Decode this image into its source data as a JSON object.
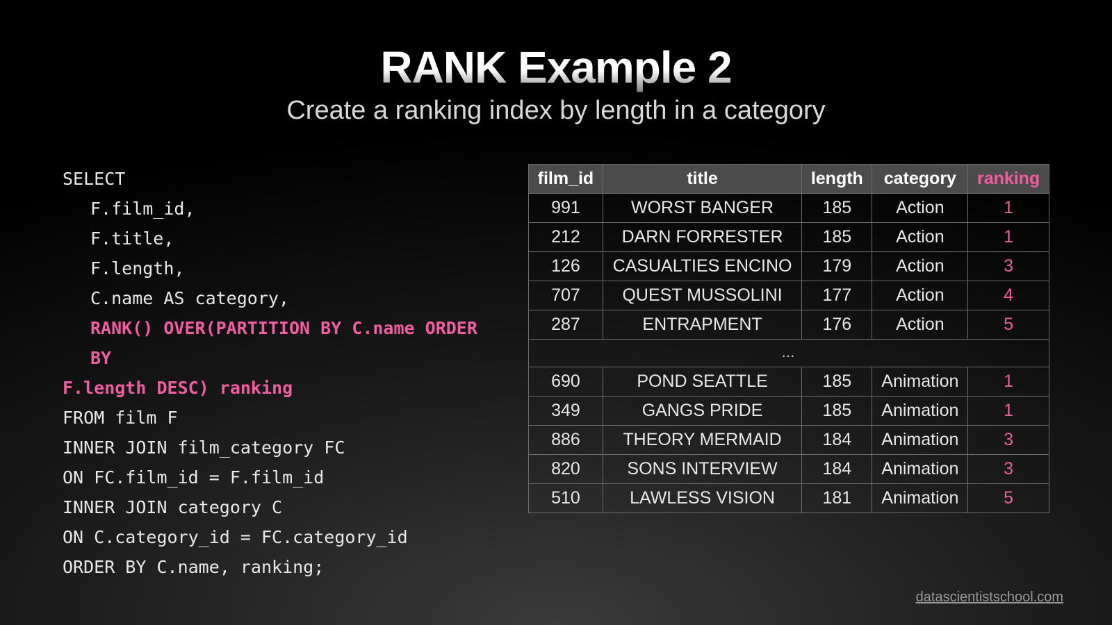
{
  "title": "RANK Example 2",
  "subtitle": "Create a ranking index by length in a category",
  "code": {
    "l1": "SELECT",
    "l2": "F.film_id,",
    "l3": "F.title,",
    "l4": "F.length,",
    "l5": "C.name AS category,",
    "l6a": "RANK() OVER(PARTITION BY C.name ORDER BY",
    "l6b": "F.length DESC) ranking",
    "l7": "FROM film F",
    "l8": "INNER JOIN film_category FC",
    "l9": "ON FC.film_id = F.film_id",
    "l10": "INNER JOIN category C",
    "l11": "ON C.category_id = FC.category_id",
    "l12": "ORDER BY C.name, ranking;"
  },
  "table": {
    "headers": [
      "film_id",
      "title",
      "length",
      "category",
      "ranking"
    ],
    "block1": [
      {
        "film_id": "991",
        "title": "WORST BANGER",
        "length": "185",
        "category": "Action",
        "ranking": "1"
      },
      {
        "film_id": "212",
        "title": "DARN FORRESTER",
        "length": "185",
        "category": "Action",
        "ranking": "1"
      },
      {
        "film_id": "126",
        "title": "CASUALTIES ENCINO",
        "length": "179",
        "category": "Action",
        "ranking": "3"
      },
      {
        "film_id": "707",
        "title": "QUEST MUSSOLINI",
        "length": "177",
        "category": "Action",
        "ranking": "4"
      },
      {
        "film_id": "287",
        "title": "ENTRAPMENT",
        "length": "176",
        "category": "Action",
        "ranking": "5"
      }
    ],
    "sep": "…",
    "block2": [
      {
        "film_id": "690",
        "title": "POND SEATTLE",
        "length": "185",
        "category": "Animation",
        "ranking": "1"
      },
      {
        "film_id": "349",
        "title": "GANGS PRIDE",
        "length": "185",
        "category": "Animation",
        "ranking": "1"
      },
      {
        "film_id": "886",
        "title": "THEORY MERMAID",
        "length": "184",
        "category": "Animation",
        "ranking": "3"
      },
      {
        "film_id": "820",
        "title": "SONS INTERVIEW",
        "length": "184",
        "category": "Animation",
        "ranking": "3"
      },
      {
        "film_id": "510",
        "title": "LAWLESS VISION",
        "length": "181",
        "category": "Animation",
        "ranking": "5"
      }
    ]
  },
  "footer": "datascientistschool.com"
}
